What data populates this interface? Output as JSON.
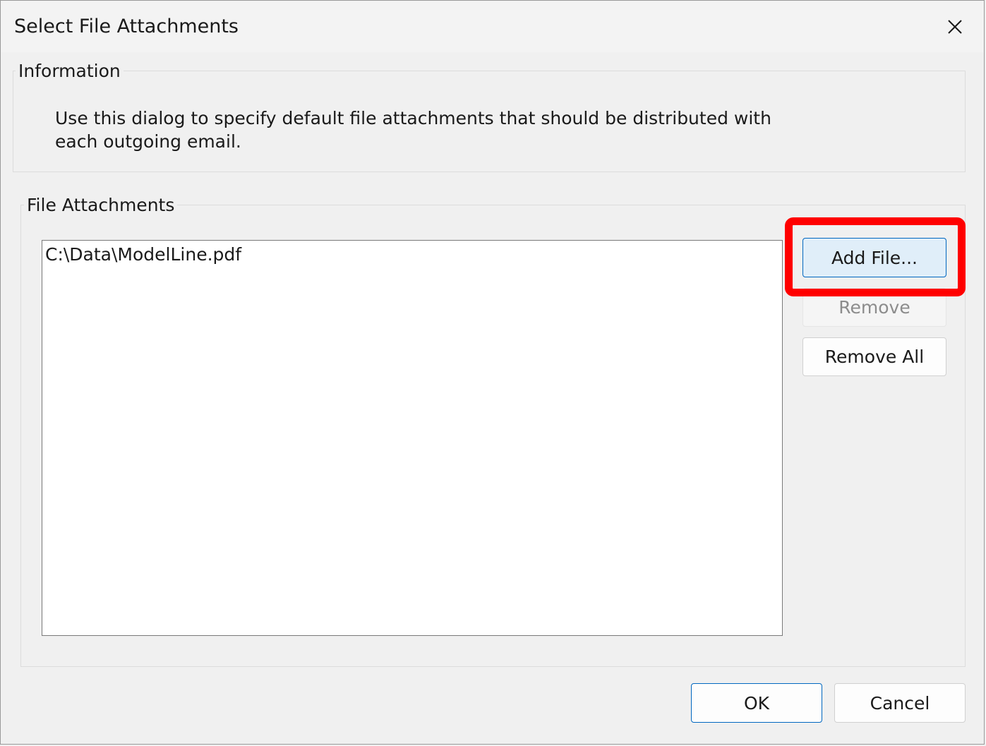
{
  "dialog": {
    "title": "Select File Attachments"
  },
  "information": {
    "legend": "Information",
    "text": "Use this dialog to specify default file attachments that should be distributed with each outgoing email."
  },
  "attachments": {
    "legend": "File Attachments",
    "files": [
      "C:\\Data\\ModelLine.pdf"
    ]
  },
  "buttons": {
    "add_file": "Add File...",
    "remove": "Remove",
    "remove_all": "Remove All",
    "ok": "OK",
    "cancel": "Cancel"
  },
  "colors": {
    "highlight": "#ff0000",
    "accent": "#0067c0",
    "add_button_bg": "#e0eef9"
  },
  "icons": {
    "close": "close-icon"
  }
}
